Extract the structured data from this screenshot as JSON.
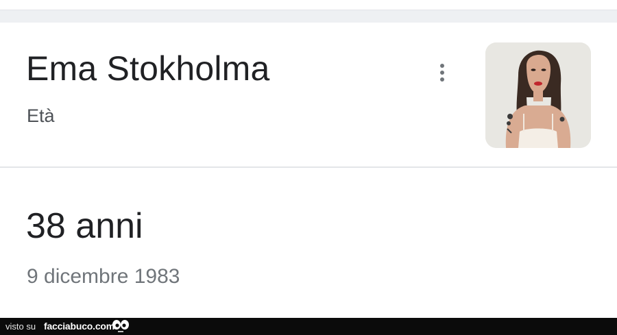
{
  "entity": {
    "name": "Ema Stokholma",
    "attribute_label": "Età",
    "value": "38 anni",
    "birth_date": "9 dicembre 1983"
  },
  "thumbnail": {
    "alt": "Ema Stokholma"
  },
  "footer": {
    "prefix": "visto su",
    "site": "facciabuco.com"
  },
  "colors": {
    "title": "#202124",
    "subtitle": "#4d5156",
    "muted": "#70757a",
    "divider": "#e3e5e8",
    "top_band": "#eef0f3",
    "footer_bg": "#0b0b0b"
  },
  "icons": {
    "menu": "more-vert-icon",
    "footer_logo": "eyes-logo-icon"
  }
}
